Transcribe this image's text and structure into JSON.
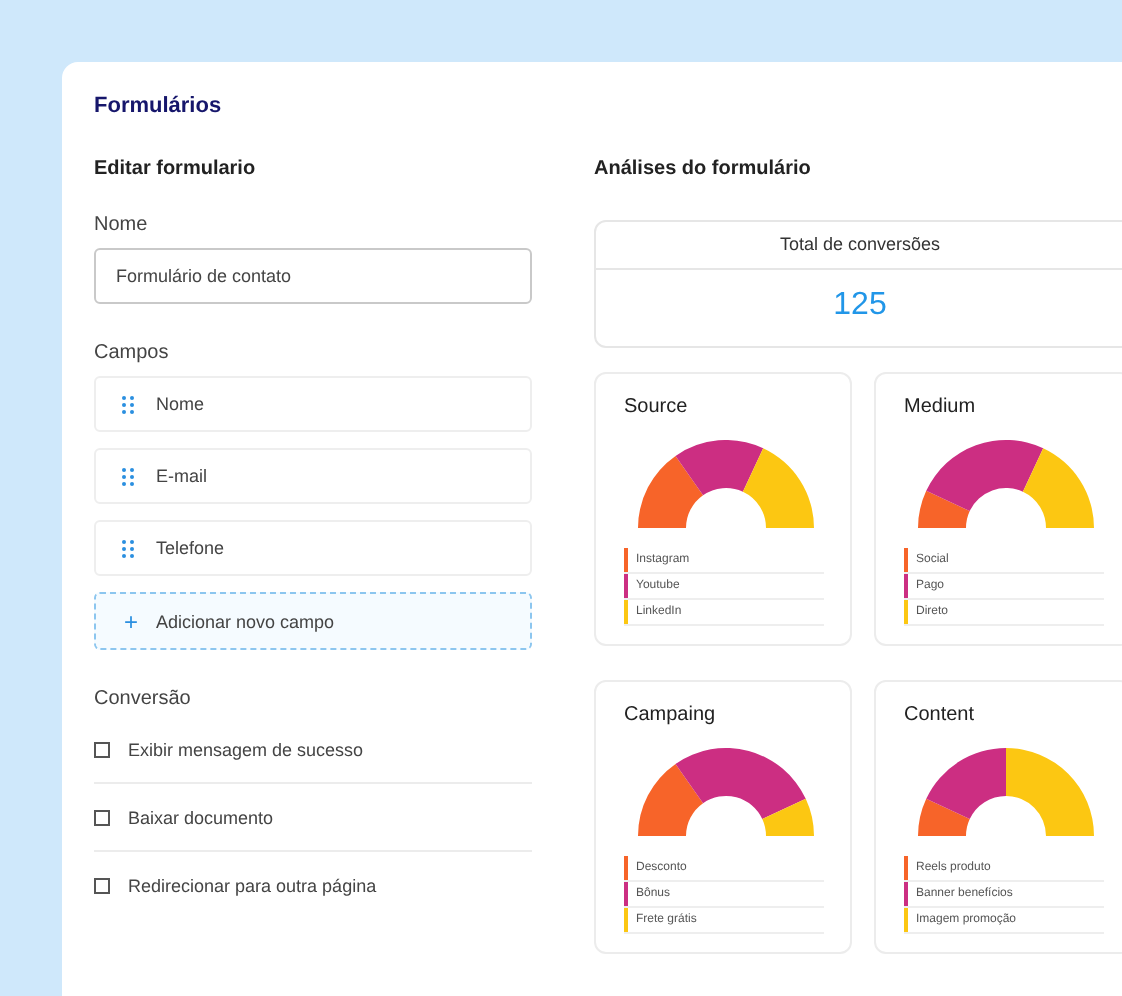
{
  "panel": {
    "title": "Formulários"
  },
  "editor": {
    "heading": "Editar formulario",
    "name_label": "Nome",
    "name_value": "Formulário de contato",
    "fields_label": "Campos",
    "fields": [
      {
        "label": "Nome"
      },
      {
        "label": "E-mail"
      },
      {
        "label": "Telefone"
      }
    ],
    "add_field": {
      "icon": "+",
      "label": "Adicionar novo campo"
    },
    "conversion_label": "Conversão",
    "conversion_options": [
      {
        "label": "Exibir mensagem de sucesso",
        "checked": false
      },
      {
        "label": "Baixar documento",
        "checked": false
      },
      {
        "label": "Redirecionar para outra página",
        "checked": false
      }
    ]
  },
  "analytics": {
    "heading": "Análises do formulário",
    "total": {
      "label": "Total de conversões",
      "value": "125"
    },
    "cards": [
      {
        "title": "Source",
        "legend": [
          {
            "label": "Instagram",
            "color": "#f76429"
          },
          {
            "label": "Youtube",
            "color": "#cc2e82"
          },
          {
            "label": "LinkedIn",
            "color": "#fcc712"
          }
        ]
      },
      {
        "title": "Medium",
        "legend": [
          {
            "label": "Social",
            "color": "#f76429"
          },
          {
            "label": "Pago",
            "color": "#cc2e82"
          },
          {
            "label": "Direto",
            "color": "#fcc712"
          }
        ]
      },
      {
        "title": "Campaing",
        "legend": [
          {
            "label": "Desconto",
            "color": "#f76429"
          },
          {
            "label": "Bônus",
            "color": "#cc2e82"
          },
          {
            "label": "Frete grátis",
            "color": "#fcc712"
          }
        ]
      },
      {
        "title": "Content",
        "legend": [
          {
            "label": "Reels produto",
            "color": "#f76429"
          },
          {
            "label": "Banner benefícios",
            "color": "#cc2e82"
          },
          {
            "label": "Imagem promoção",
            "color": "#fcc712"
          }
        ]
      }
    ]
  }
}
